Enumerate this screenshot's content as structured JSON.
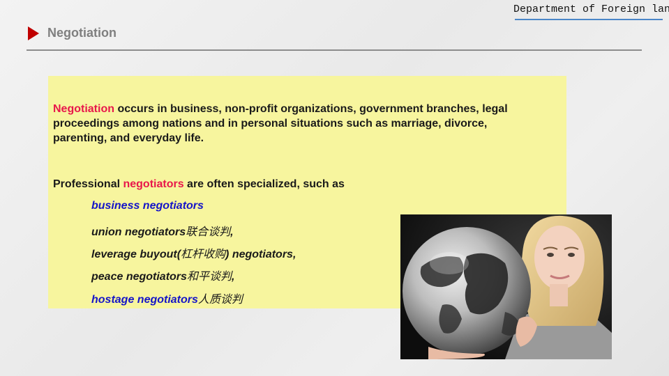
{
  "header": {
    "department": "Department of Foreign lan",
    "title": "Negotiation"
  },
  "content": {
    "p1_term": "Negotiation",
    "p1_rest": " occurs in business, non-profit organizations, government branches, legal proceedings among nations and in personal situations such as marriage, divorce, parenting, and everyday life.",
    "p2_pre": "Professional ",
    "p2_term": "negotiators",
    "p2_post": " are often specialized, such as",
    "items": [
      {
        "en": "business negotiators",
        "cn": "",
        "tail": ""
      },
      {
        "en": "union negotiators",
        "cn": "联合谈判",
        "tail": ","
      },
      {
        "en": "leverage buyout(",
        "cn": "杠杆收购",
        "tail": ") negotiators,"
      },
      {
        "en": "peace negotiators",
        "cn": "和平谈判",
        "tail": ","
      },
      {
        "en": "hostage negotiators",
        "cn": "人质谈判",
        "tail": ""
      }
    ]
  },
  "colors": {
    "accent_red": "#c00000",
    "term_red": "#e8174b",
    "highlight_blue": "#1515c8",
    "box_yellow": "#f7f59e"
  }
}
